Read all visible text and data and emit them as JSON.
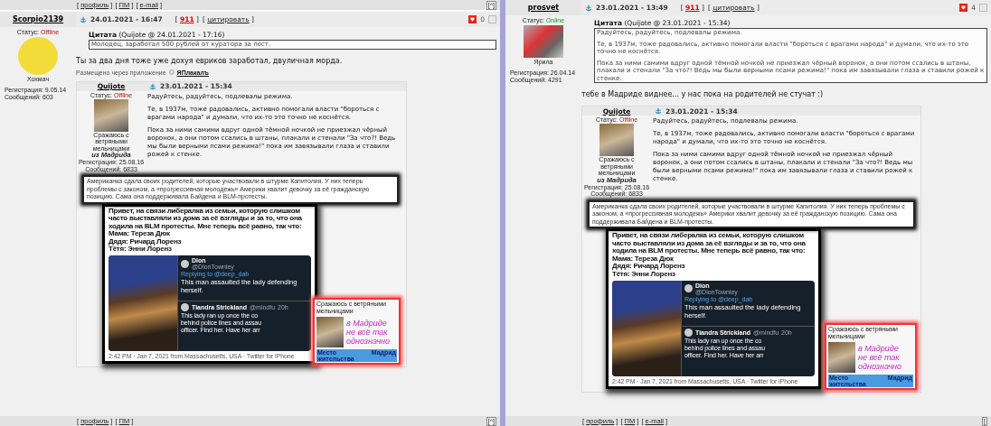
{
  "panels": [
    {
      "top_links": [
        {
          "open": "[",
          "label": "профиль",
          "close": "]"
        },
        {
          "open": "[",
          "label": "ПМ",
          "close": "]"
        },
        {
          "open": "[",
          "label": "e-mail",
          "close": "]"
        }
      ],
      "top_button": "[^]",
      "post": {
        "author": "Scorpio2139",
        "date": "24.01.2021 - 16:47",
        "rating": {
          "open": "[",
          "label": "911",
          "close": "]"
        },
        "quote_link": {
          "open": "[",
          "label": "цитировать",
          "close": "]"
        },
        "votes": "0",
        "status_label": "Статус:",
        "status": "Offline",
        "online": false,
        "avatar_caption": "Хохмач",
        "registration": "Регистрация: 9.05.14",
        "messages": "Сообщений: 603",
        "quote": {
          "title": "Цитата",
          "source": "(Quijote @ 24.01.2021 - 17:16)",
          "paragraphs": [
            "Молодец, заработал 500 рублей от куратора за пост."
          ]
        },
        "body": "Ты за два дня тоже уже дохуя евриков заработал, двуличная морда.",
        "app_note": {
          "text": "Размещено через приложение",
          "link": "ЯПлакалъ"
        },
        "nested": {
          "author": "Quijote",
          "date": "23.01.2021 - 15:34",
          "status_label": "Статус:",
          "status": "Offline",
          "online": false,
          "signature": "Сражаюсь с ветряными мельницами",
          "location": "из Мадрида",
          "registration": "Регистрация: 25.08.16",
          "messages": "Сообщений: 6833",
          "paragraphs": [
            "Радуйтесь, радуйтесь, подлевалы режима.",
            "Те, в 1937м, тоже радовались, активно помогали власти \"бороться с врагами народа\" и думали, что их-то это точно не коснётся.",
            "Пока за ними самими вдруг одной тёмной ночкой не приезжал чёрный воронок, а они потом ссались в штаны, плакали и стенали \"За что?! Ведь мы были верными псами режима!\" пока им завязывали глаза и ставили рожей к стенке."
          ],
          "caption": "Американка сдала своих родителей, которые участвовали в штурме Капитолия. У них теперь проблемы с законом, а «прогрессивная молодежь» Америки хвалит девочку за её гражданскую позицию. Сама она поддерживала Байдена и BLM-протесты.",
          "headline": [
            "Привет, на связи либералка из семьи, которую слишком",
            "часто выставляли из дома за её взгляды и за то, что она",
            "ходила на BLM протесты. Мне теперь всё равно, так что:",
            "Мама: Тереза Дюк",
            "Дядя: Ричард Лоренз",
            "Тётя: Энни Лоренз"
          ],
          "tweet1": {
            "name": "Dion",
            "handle": "@DionTownley",
            "reply": "Replying to @deep_dab",
            "text": "This man assaulted the lady defending herself."
          },
          "tweet2": {
            "name": "Tiandra Strickland",
            "handle": "@mindfu",
            "age": "20h",
            "lines": [
              "This lady ran up once the co",
              "behind police lines and assau",
              "officer. Find her. Have her arr"
            ]
          },
          "footer": "2:42 PM · Jan 7, 2021 from Massachusetts, USA · Twitter for iPhone",
          "sig_card": {
            "title": "Сражаюсь с ветряными мельницами",
            "lines": [
              "в Мадриде",
              "не всё так",
              "однозначно"
            ],
            "field": "Место жительства",
            "value": "Мадрид"
          }
        }
      },
      "bottom_links": [
        {
          "open": "[",
          "label": "профиль",
          "close": "]"
        },
        {
          "open": "[",
          "label": "ПМ",
          "close": "]"
        }
      ],
      "bottom_button": "[^]"
    },
    {
      "post": {
        "author": "prosvet",
        "date": "23.01.2021 - 13:49",
        "rating": {
          "open": "[",
          "label": "911",
          "close": "]"
        },
        "quote_link": {
          "open": "[",
          "label": "цитировать",
          "close": "]"
        },
        "votes": "4",
        "status_label": "Статус:",
        "status": "Online",
        "online": true,
        "avatar_caption": "Ярила",
        "registration": "Регистрация: 26.04.14",
        "messages": "Сообщений: 4291",
        "quote": {
          "title": "Цитата",
          "source": "(Quijote @ 23.01.2021 - 15:34)",
          "paragraphs": [
            "Радуйтесь, радуйтесь, подлевалы режима.",
            "Те, в 1937м, тоже радовались, активно помогали власти \"бороться с врагами народа\" и думали, что их-то это точно не коснётся.",
            "Пока за ними самими вдруг одной тёмной ночкой не приезжал чёрный воронок, а они потом ссались в штаны, плакали и стенали \"За что?! Ведь мы были верными псами режима!\" пока им завязывали глаза и ставили рожей к стенке."
          ]
        },
        "body": "тебе в Мадриде виднее... у нас пока на родителей не стучат :)",
        "nested": {
          "author": "Quijote",
          "date": "23.01.2021 - 15:34",
          "status_label": "Статус:",
          "status": "Offline",
          "online": false,
          "signature": "Сражаюсь с ветряными мельницами",
          "location": "из Мадрида",
          "registration": "Регистрация: 25.08.16",
          "messages": "Сообщений: 6833",
          "paragraphs": [
            "Радуйтесь, радуйтесь, подлевалы режима.",
            "Те, в 1937м, тоже радовались, активно помогали власти \"бороться с врагами народа\" и думали, что их-то это точно не коснётся.",
            "Пока за ними самими вдруг одной тёмной ночкой не приезжал чёрный воронок, а они потом ссались в штаны, плакали и стенали \"За что?! Ведь мы были верными псами режима!\" пока им завязывали глаза и ставили рожей к стенке."
          ],
          "caption": "Американка сдала своих родителей, которые участвовали в штурме Капитолия. У них теперь проблемы с законом, а «прогрессивная молодежь» Америки хвалит девочку за её гражданскую позицию. Сама она поддерживала Байдена и BLM-протесты.",
          "headline": [
            "Привет, на связи либералка из семьи, которую слишком",
            "часто выставляли из дома за её взгляды и за то, что она",
            "ходила на BLM протесты. Мне теперь всё равно, так что:",
            "Мама: Тереза Дюк",
            "Дядя: Ричард Лоренз",
            "Тётя: Энни Лоренз"
          ],
          "tweet1": {
            "name": "Dion",
            "handle": "@DionTownley",
            "reply": "Replying to @deep_dab",
            "text": "This man assaulted the lady defending herself."
          },
          "tweet2": {
            "name": "Tiandra Strickland",
            "handle": "@mindfu",
            "age": "20h",
            "lines": [
              "This lady ran up once the co",
              "behind police lines and assau",
              "officer. Find her. Have her arr"
            ]
          },
          "footer": "2:42 PM · Jan 7, 2021 from Massachusetts, USA · Twitter for iPhone",
          "sig_card": {
            "title": "Сражаюсь с ветряными мельницами",
            "lines": [
              "в Мадриде",
              "не всё так",
              "однозначно"
            ],
            "field": "Место жительства",
            "value": "Мадрид"
          }
        }
      },
      "bottom_links": [
        {
          "open": "[",
          "label": "профиль",
          "close": "]"
        },
        {
          "open": "[",
          "label": "ПМ",
          "close": "]"
        },
        {
          "open": "[",
          "label": "e-mail",
          "close": "]"
        }
      ],
      "bottom_button": "["
    }
  ]
}
